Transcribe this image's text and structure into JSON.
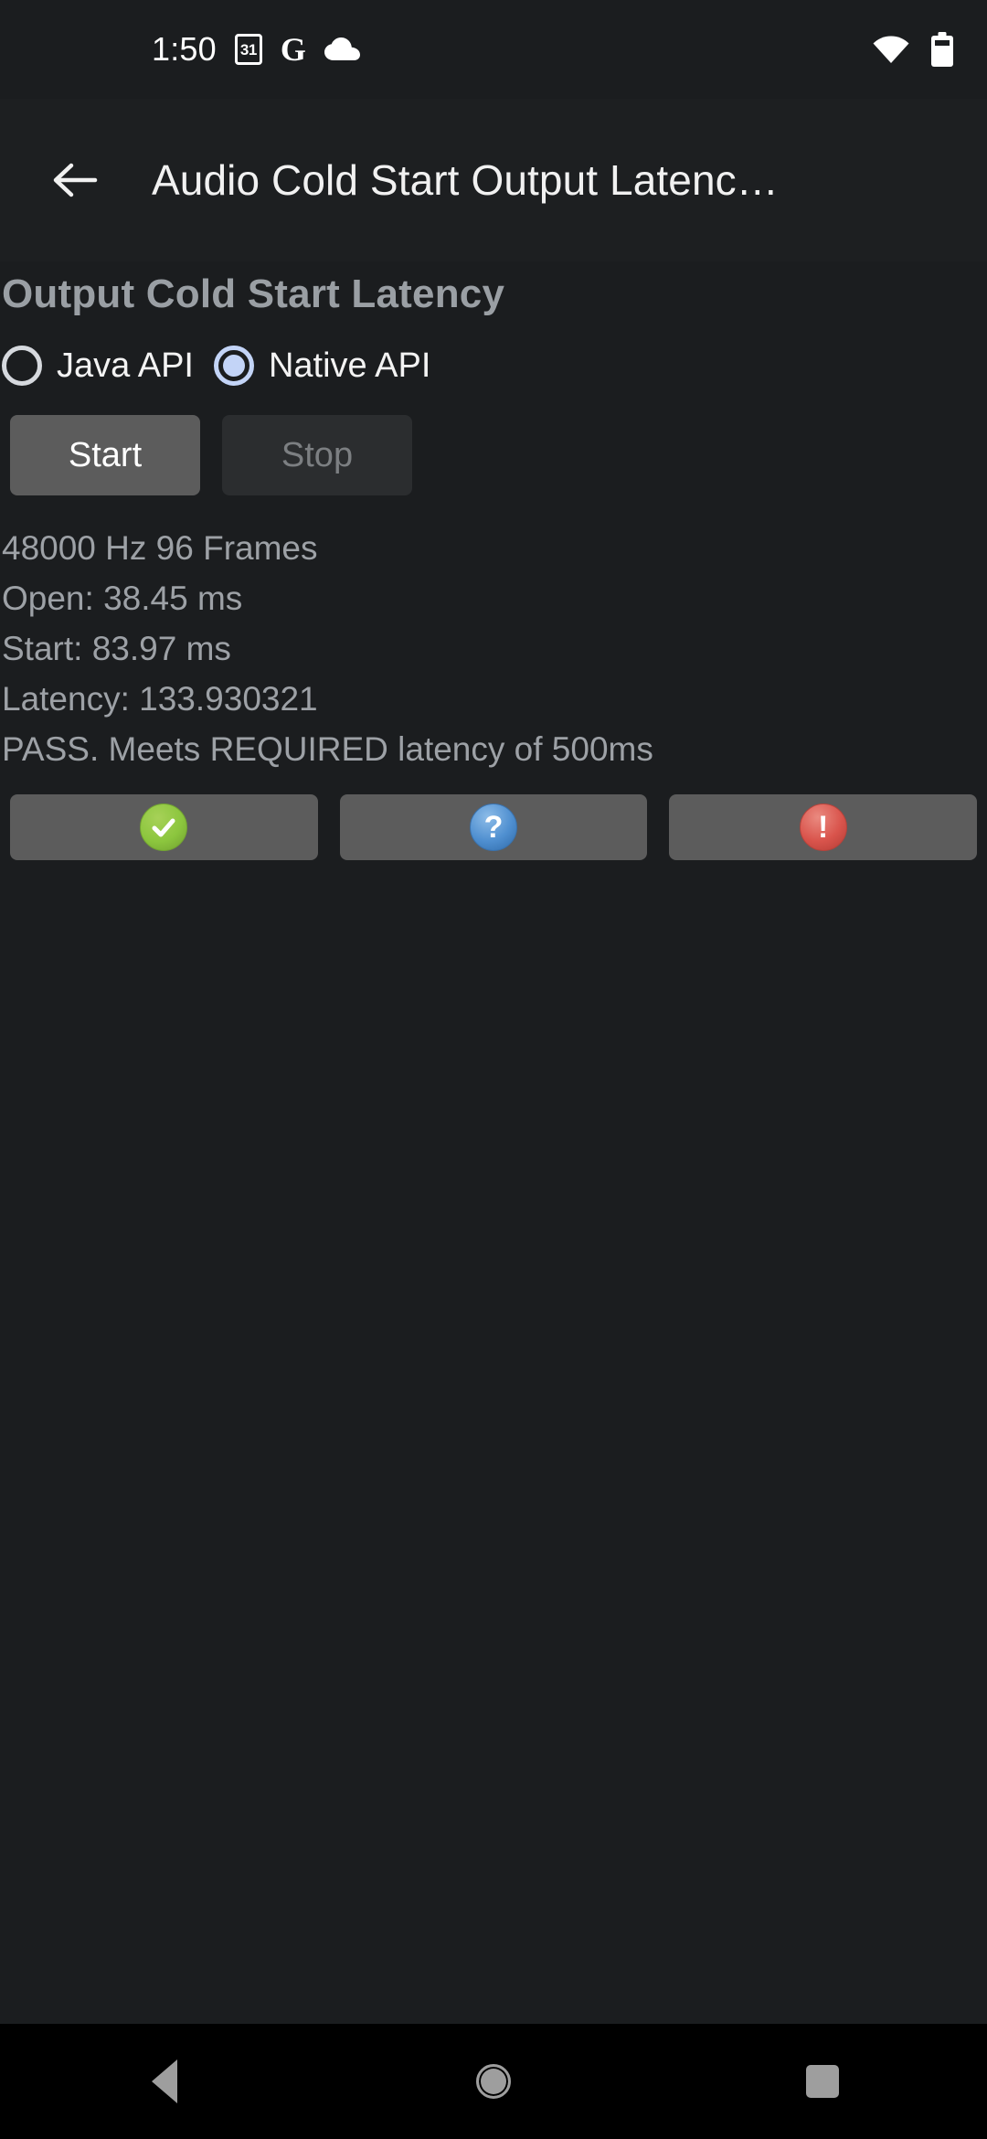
{
  "status_bar": {
    "clock": "1:50",
    "calendar_day": "31",
    "google_glyph": "G",
    "icons": [
      "calendar-icon",
      "google-icon",
      "cloud-icon",
      "wifi-icon",
      "battery-icon"
    ]
  },
  "app_bar": {
    "back_label": "Back",
    "title": "Audio Cold Start Output Latenc…"
  },
  "main": {
    "heading": "Output Cold Start Latency",
    "radios": [
      {
        "label": "Java API",
        "selected": false
      },
      {
        "label": "Native API",
        "selected": true
      }
    ],
    "buttons": {
      "start_label": "Start",
      "start_enabled": true,
      "stop_label": "Stop",
      "stop_enabled": false
    },
    "results": [
      "48000 Hz 96 Frames",
      "Open: 38.45 ms",
      "Start: 83.97 ms",
      "Latency: 133.930321",
      "PASS. Meets REQUIRED latency of 500ms"
    ],
    "result_values": {
      "sample_rate_hz": "48000",
      "frames": "96",
      "open_ms": "38.45",
      "start_ms": "83.97",
      "latency": "133.930321",
      "verdict": "PASS",
      "required_latency_ms": "500"
    },
    "status_buttons": [
      {
        "name": "pass-button",
        "glyph": "check",
        "color": "#8cc63e"
      },
      {
        "name": "info-button",
        "glyph": "question",
        "color": "#4f8fd0"
      },
      {
        "name": "fail-button",
        "glyph": "exclamation",
        "color": "#d9544c"
      }
    ]
  },
  "nav_bar": {
    "back_label": "Back",
    "home_label": "Home",
    "recents_label": "Recents"
  },
  "colors": {
    "background": "#1b1d1f",
    "app_bar": "#1d1f21",
    "nav_bar": "#000000",
    "heading_text": "#9a9fa4",
    "body_text": "#9da1a6",
    "accent_radio": "#c3d4f7",
    "button_enabled": "#5c5c5c",
    "button_disabled": "#2b2d2f"
  }
}
